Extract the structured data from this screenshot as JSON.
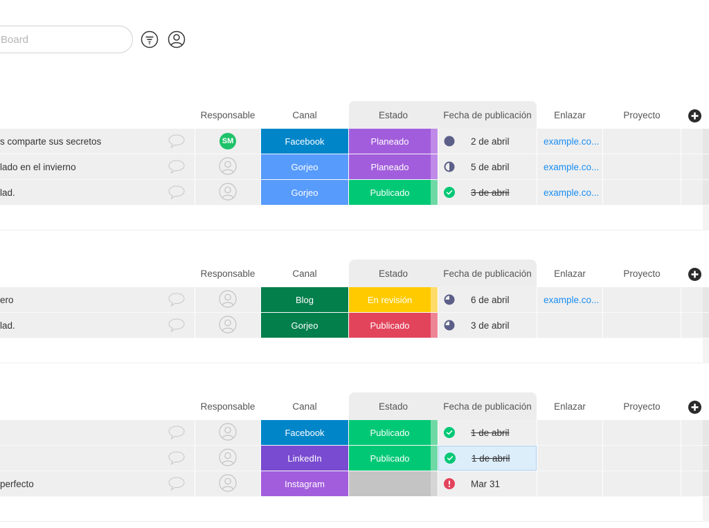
{
  "toolbar": {
    "search_placeholder": "Board",
    "filter_icon": "filter-icon",
    "person_icon": "person-filter-icon"
  },
  "columns": {
    "responsable": "Responsable",
    "canal": "Canal",
    "estado": "Estado",
    "fecha": "Fecha de publicación",
    "enlazar": "Enlazar",
    "proyecto": "Proyecto"
  },
  "colors": {
    "facebook": "#0085c9",
    "gorjeo_blue": "#579bfc",
    "gorjeo_green": "#037f4c",
    "blog": "#037f4c",
    "linkedin": "#784bd1",
    "instagram": "#a25ddc",
    "planeado": "#a25ddc",
    "publicado_green": "#00c875",
    "en_revision": "#ffcb00",
    "publicado_red": "#e2445c",
    "empty_status": "#c4c4c4",
    "link": "#1a8ef0",
    "avatar_sm": "#1fc26a"
  },
  "groups": [
    {
      "rows": [
        {
          "name": "s comparte sus secretos",
          "responsable": "SM",
          "canal": "Facebook",
          "canal_color": "#0085c9",
          "estado": "Planeado",
          "estado_color": "#a25ddc",
          "edge_color": "#bf8ae8",
          "fecha_icon": "full-circle",
          "fecha": "2 de abril",
          "strike": false,
          "enlace": "example.co..."
        },
        {
          "name": "lado en el invierno",
          "responsable": "",
          "canal": "Gorjeo",
          "canal_color": "#579bfc",
          "estado": "Planeado",
          "estado_color": "#a25ddc",
          "edge_color": "#bf8ae8",
          "fecha_icon": "half-circle",
          "fecha": "5 de abril",
          "strike": false,
          "enlace": "example.co..."
        },
        {
          "name": "lad.",
          "responsable": "",
          "canal": "Gorjeo",
          "canal_color": "#579bfc",
          "estado": "Publicado",
          "estado_color": "#00c875",
          "edge_color": "#6fd9a6",
          "fecha_icon": "check-circle",
          "fecha": "3 de abril",
          "strike": true,
          "enlace": "example.co..."
        }
      ]
    },
    {
      "rows": [
        {
          "name": "ero",
          "responsable": "",
          "canal": "Blog",
          "canal_color": "#037f4c",
          "estado": "En revisión",
          "estado_color": "#ffcb00",
          "edge_color": "#ffdc6a",
          "fecha_icon": "three-quarter-circle",
          "fecha": "6 de abril",
          "strike": false,
          "enlace": "example.co..."
        },
        {
          "name": "lad.",
          "responsable": "",
          "canal": "Gorjeo",
          "canal_color": "#037f4c",
          "estado": "Publicado",
          "estado_color": "#e2445c",
          "edge_color": "#ee8595",
          "fecha_icon": "three-quarter-circle",
          "fecha": "3 de abril",
          "strike": false,
          "enlace": ""
        }
      ]
    },
    {
      "rows": [
        {
          "name": "",
          "responsable": "",
          "canal": "Facebook",
          "canal_color": "#0085c9",
          "estado": "Publicado",
          "estado_color": "#00c875",
          "edge_color": "#6fd9a6",
          "fecha_icon": "check-circle",
          "fecha": "1 de abril",
          "strike": true,
          "enlace": "",
          "selected": false
        },
        {
          "name": "",
          "responsable": "",
          "canal": "LinkedIn",
          "canal_color": "#784bd1",
          "estado": "Publicado",
          "estado_color": "#00c875",
          "edge_color": "#6fd9a6",
          "fecha_icon": "check-circle",
          "fecha": "1 de abril",
          "strike": true,
          "enlace": "",
          "selected": true
        },
        {
          "name": "perfecto",
          "responsable": "",
          "canal": "Instagram",
          "canal_color": "#a25ddc",
          "estado": "",
          "estado_color": "#c4c4c4",
          "edge_color": "#d6d6d6",
          "fecha_icon": "alert-circle",
          "fecha": "Mar 31",
          "strike": false,
          "enlace": ""
        }
      ]
    }
  ]
}
